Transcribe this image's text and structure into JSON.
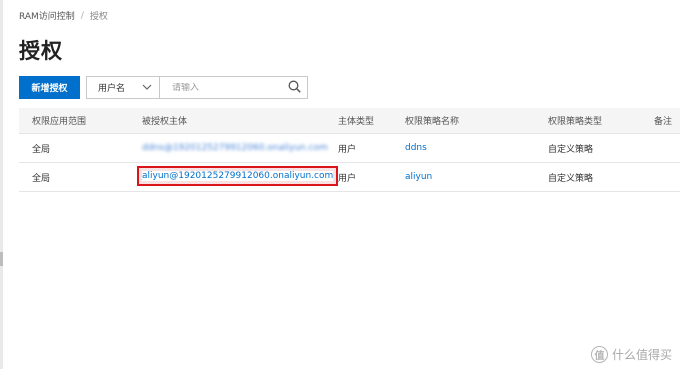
{
  "breadcrumb": {
    "root": "RAM访问控制",
    "separator": "/",
    "current": "授权"
  },
  "page": {
    "title": "授权"
  },
  "toolbar": {
    "new_button": "新增授权",
    "filter_select": {
      "value": "用户名",
      "icon": "chevron-down-icon"
    },
    "search": {
      "placeholder": "请输入",
      "value": "",
      "icon": "search-icon"
    }
  },
  "table": {
    "columns": [
      "权限应用范围",
      "被授权主体",
      "主体类型",
      "权限策略名称",
      "权限策略类型",
      "备注"
    ],
    "rows": [
      {
        "scope": "全局",
        "principal": "ddns@1920125279912060.onaliyun.com",
        "principal_type": "用户",
        "policy_name": "ddns",
        "policy_type": "自定义策略",
        "note": ""
      },
      {
        "scope": "全局",
        "principal": "aliyun@1920125279912060.onaliyun.com",
        "principal_type": "用户",
        "policy_name": "aliyun",
        "policy_type": "自定义策略",
        "note": ""
      }
    ]
  },
  "watermark": {
    "logo_char": "值",
    "text": "什么值得买"
  },
  "colors": {
    "primary": "#0070cc",
    "highlight": "#d9141a",
    "header_bg": "#f5f5f5"
  }
}
